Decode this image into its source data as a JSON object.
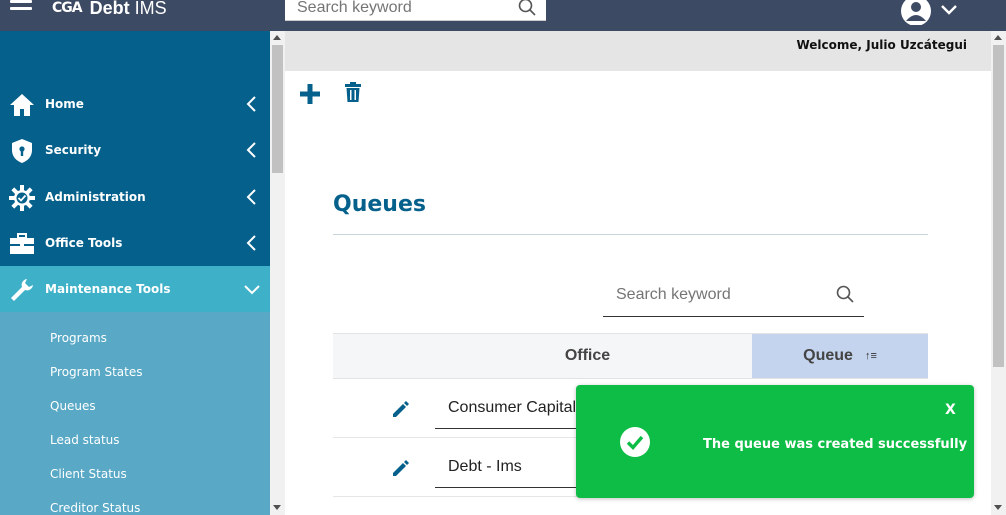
{
  "header": {
    "logo_mark": "CGA",
    "app_name_bold": "Debt",
    "app_name_rest": " IMS",
    "search_placeholder": "Search keyword"
  },
  "sidebar": {
    "items": [
      {
        "label": "Home",
        "icon": "home-icon"
      },
      {
        "label": "Security",
        "icon": "shield-icon"
      },
      {
        "label": "Administration",
        "icon": "gear-icon"
      },
      {
        "label": "Office Tools",
        "icon": "toolbox-icon"
      },
      {
        "label": "Maintenance Tools",
        "icon": "wrench-icon",
        "expanded": true
      }
    ],
    "subitems": [
      "Programs",
      "Program States",
      "Queues",
      "Lead status",
      "Client Status",
      "Creditor Status"
    ]
  },
  "main": {
    "welcome": "Welcome, Julio Uzcátegui",
    "title": "Queues",
    "search_placeholder": "Search keyword",
    "columns": [
      "Office",
      "Queue"
    ],
    "sort_indicator": "↑≡",
    "rows": [
      {
        "office": "Consumer Capital"
      },
      {
        "office": "Debt - Ims"
      }
    ]
  },
  "toast": {
    "message": "The queue was created successfully",
    "close_label": "X"
  },
  "colors": {
    "topbar": "#3d4a63",
    "sidebar": "#05618c",
    "sidebar_active": "#3eb1c8",
    "submenu": "#59a9c6",
    "title": "#05618c",
    "sorted_column": "#c5d4ee",
    "toast": "#0dbd45"
  }
}
